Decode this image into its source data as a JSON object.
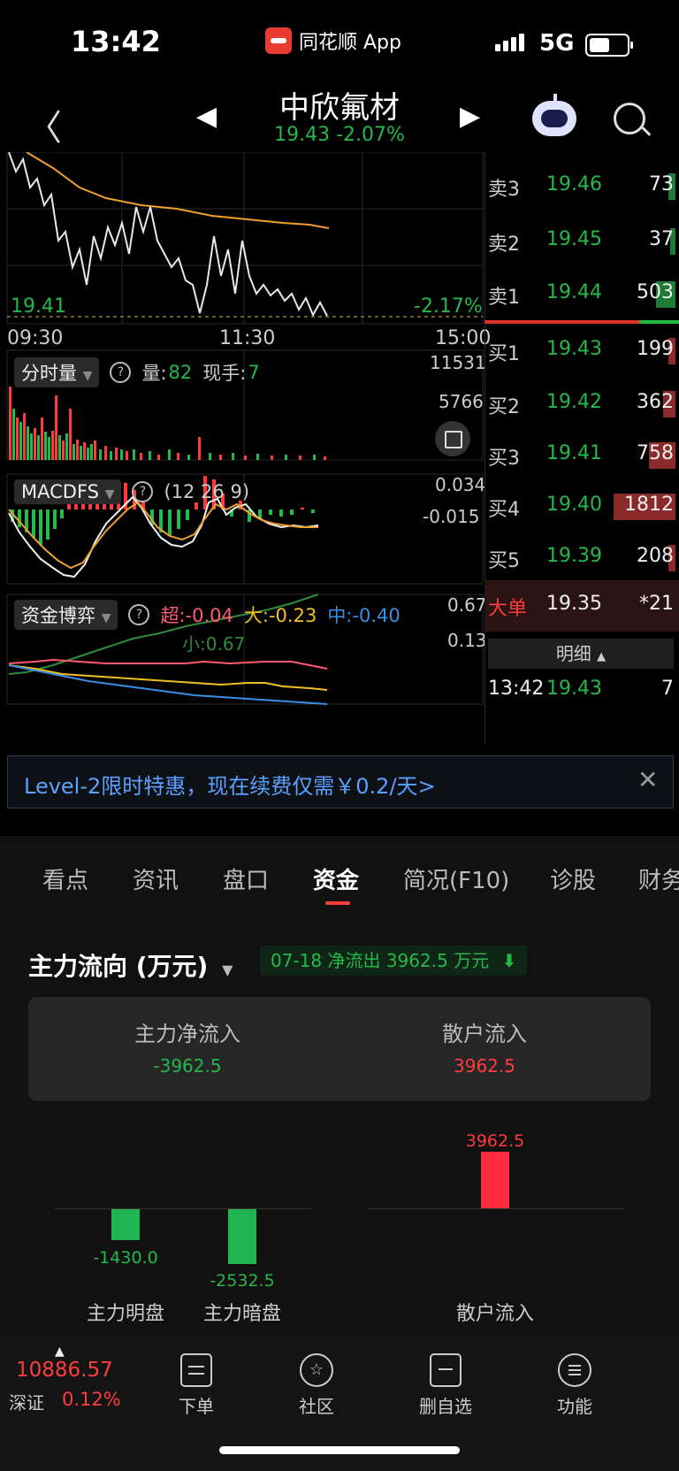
{
  "status_bar": {
    "time": "13:42",
    "app_name": "同花顺 App",
    "network": "5G"
  },
  "header": {
    "stock_name": "中欣氟材",
    "price_line": "19.43 -2.07%"
  },
  "chart": {
    "price_low_label": "19.41",
    "pct_low_label": "-2.17%",
    "time_axis": [
      "09:30",
      "11:30",
      "15:00"
    ],
    "volume": {
      "indicator": "分时量",
      "vol_label": "量:",
      "vol_value": "82",
      "hand_label": "现手:",
      "hand_value": "7",
      "max": "11531",
      "mid": "5766"
    },
    "macd": {
      "indicator": "MACDFS",
      "params": "(12  26  9)",
      "top": "0.034",
      "mid": "-0.015"
    },
    "fund_game": {
      "indicator": "资金博弈",
      "super": "超:-0.04",
      "large": "大:-0.23",
      "medium": "中:-0.40",
      "small": "小:0.67",
      "top": "0.67",
      "mid": "0.13"
    }
  },
  "order_book": {
    "asks": [
      {
        "label": "卖3",
        "price": "19.46",
        "vol": "73"
      },
      {
        "label": "卖2",
        "price": "19.45",
        "vol": "37"
      },
      {
        "label": "卖1",
        "price": "19.44",
        "vol": "503"
      }
    ],
    "bids": [
      {
        "label": "买1",
        "price": "19.43",
        "vol": "199"
      },
      {
        "label": "买2",
        "price": "19.42",
        "vol": "362"
      },
      {
        "label": "买3",
        "price": "19.41",
        "vol": "758"
      },
      {
        "label": "买4",
        "price": "19.40",
        "vol": "1812"
      },
      {
        "label": "买5",
        "price": "19.39",
        "vol": "208"
      }
    ],
    "big_order": {
      "label": "大单",
      "price": "19.35",
      "vol": "*21"
    },
    "detail_label": "明细",
    "last_trade": {
      "time": "13:42",
      "price": "19.43",
      "vol": "7"
    }
  },
  "banner": {
    "text": "Level-2限时特惠，现在续费仅需￥0.2/天>"
  },
  "tabs": [
    "看点",
    "资讯",
    "盘口",
    "资金",
    "简况(F10)",
    "诊股",
    "财务"
  ],
  "fund": {
    "title": "主力流向 (万元)",
    "badge": "07-18 净流出 3962.5 万元",
    "summary": {
      "main_label": "主力净流入",
      "main_value": "-3962.5",
      "retail_label": "散户流入",
      "retail_value": "3962.5"
    },
    "bars": [
      {
        "label": "主力明盘",
        "value": "-1430.0"
      },
      {
        "label": "主力暗盘",
        "value": "-2532.5"
      },
      {
        "label": "散户流入",
        "value": "3962.5"
      }
    ]
  },
  "bottom_nav": {
    "index_value": "10886.57",
    "index_name": "深证",
    "index_pct": "0.12%",
    "items": [
      "下单",
      "社区",
      "删自选",
      "功能"
    ]
  }
}
